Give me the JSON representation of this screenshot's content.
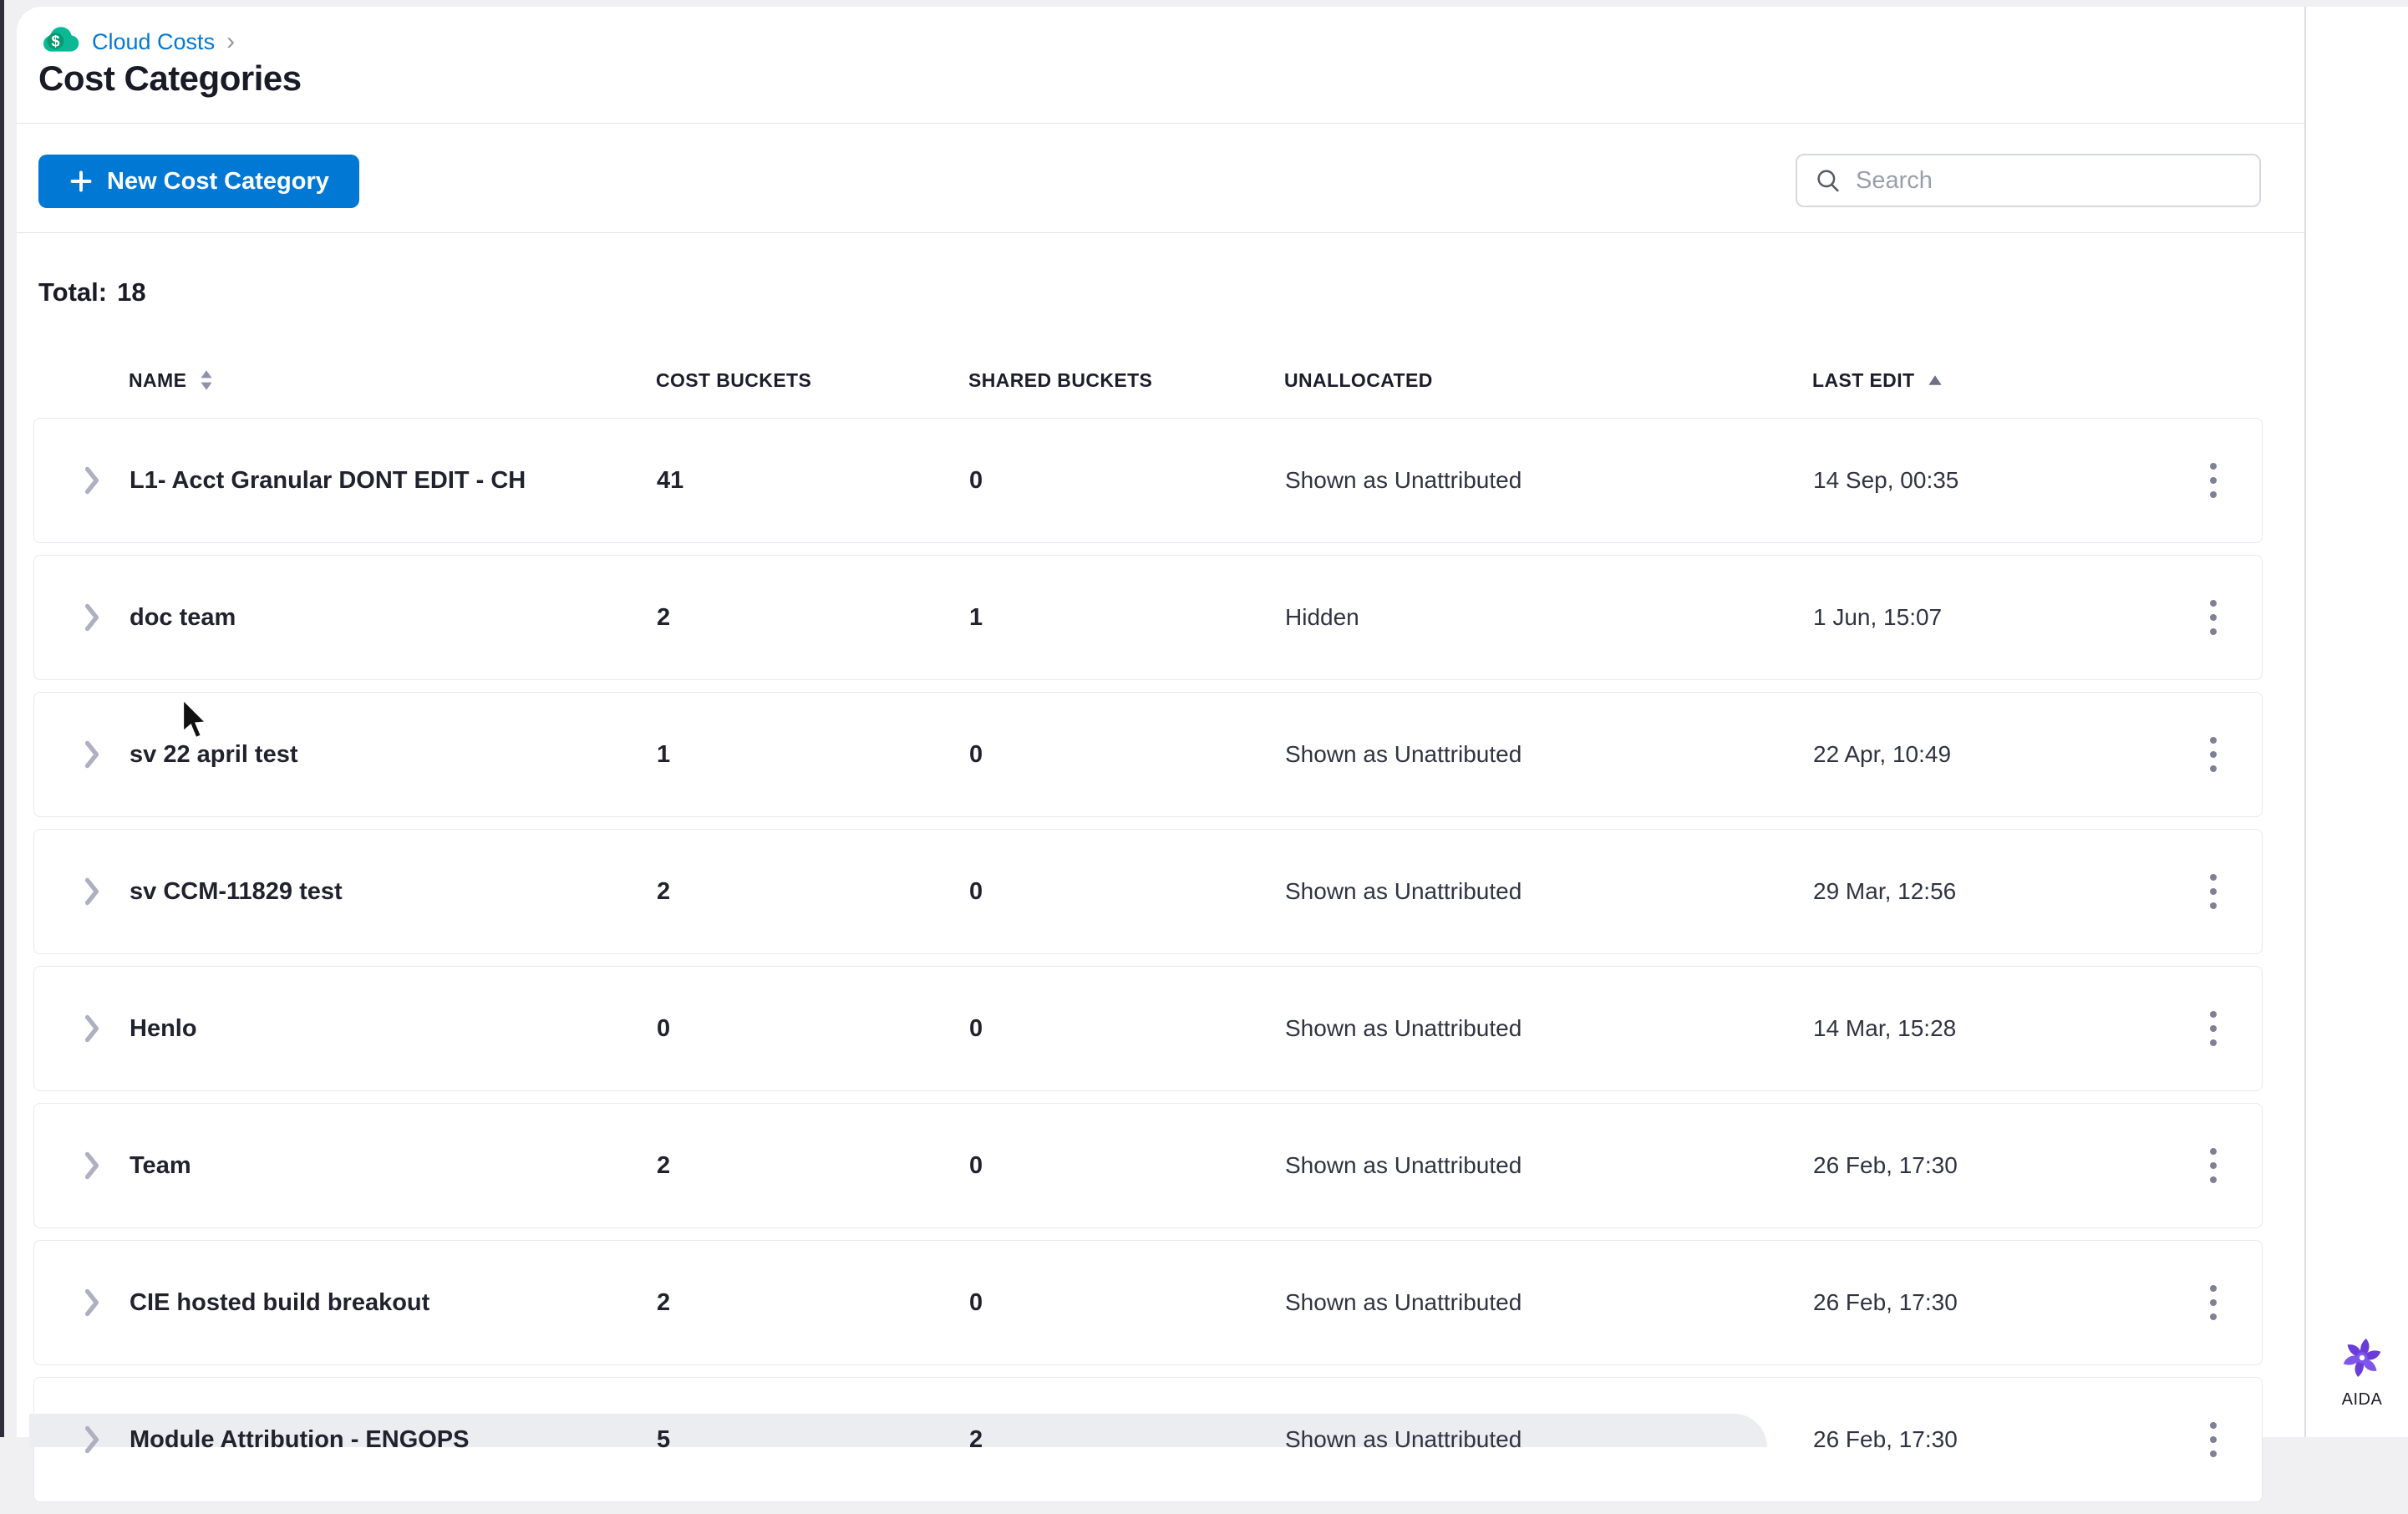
{
  "colors": {
    "accent_blue": "#0278d5",
    "ccm_teal": "#0bb896",
    "aida_purple": "#6a3ddb",
    "text_dark": "#1b1b28",
    "border_gray": "#e8e9ef"
  },
  "breadcrumb": {
    "label": "Cloud Costs",
    "separator": "›"
  },
  "page": {
    "title": "Cost Categories"
  },
  "toolbar": {
    "new_button_label": "New Cost Category",
    "search_placeholder": "Search"
  },
  "summary": {
    "total_label": "Total:",
    "total_value": "18"
  },
  "icons": {
    "dollar": "$"
  },
  "table": {
    "columns": [
      {
        "label": "NAME",
        "sort": "both"
      },
      {
        "label": "COST BUCKETS",
        "sort": "none"
      },
      {
        "label": "SHARED BUCKETS",
        "sort": "none"
      },
      {
        "label": "UNALLOCATED",
        "sort": "none"
      },
      {
        "label": "LAST EDIT",
        "sort": "asc"
      }
    ],
    "rows": [
      {
        "name": "L1- Acct Granular DONT EDIT - CH",
        "cost_buckets": "41",
        "shared_buckets": "0",
        "unallocated": "Shown as Unattributed",
        "last_edit": "14 Sep, 00:35"
      },
      {
        "name": "doc team",
        "cost_buckets": "2",
        "shared_buckets": "1",
        "unallocated": "Hidden",
        "last_edit": "1 Jun, 15:07"
      },
      {
        "name": "sv 22 april test",
        "cost_buckets": "1",
        "shared_buckets": "0",
        "unallocated": "Shown as Unattributed",
        "last_edit": "22 Apr, 10:49"
      },
      {
        "name": "sv CCM-11829 test",
        "cost_buckets": "2",
        "shared_buckets": "0",
        "unallocated": "Shown as Unattributed",
        "last_edit": "29 Mar, 12:56"
      },
      {
        "name": "Henlo",
        "cost_buckets": "0",
        "shared_buckets": "0",
        "unallocated": "Shown as Unattributed",
        "last_edit": "14 Mar, 15:28"
      },
      {
        "name": "Team",
        "cost_buckets": "2",
        "shared_buckets": "0",
        "unallocated": "Shown as Unattributed",
        "last_edit": "26 Feb, 17:30"
      },
      {
        "name": "CIE hosted build breakout",
        "cost_buckets": "2",
        "shared_buckets": "0",
        "unallocated": "Shown as Unattributed",
        "last_edit": "26 Feb, 17:30"
      },
      {
        "name": "Module Attribution - ENGOPS",
        "cost_buckets": "5",
        "shared_buckets": "2",
        "unallocated": "Shown as Unattributed",
        "last_edit": "26 Feb, 17:30"
      }
    ]
  },
  "aida": {
    "label": "AIDA"
  }
}
